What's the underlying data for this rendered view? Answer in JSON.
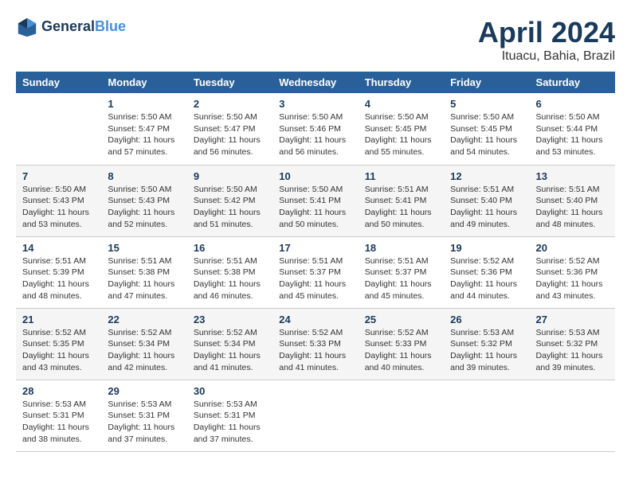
{
  "logo": {
    "line1": "General",
    "line2": "Blue"
  },
  "title": "April 2024",
  "subtitle": "Ituacu, Bahia, Brazil",
  "headers": [
    "Sunday",
    "Monday",
    "Tuesday",
    "Wednesday",
    "Thursday",
    "Friday",
    "Saturday"
  ],
  "weeks": [
    [
      {
        "day": "",
        "info": ""
      },
      {
        "day": "1",
        "info": "Sunrise: 5:50 AM\nSunset: 5:47 PM\nDaylight: 11 hours\nand 57 minutes."
      },
      {
        "day": "2",
        "info": "Sunrise: 5:50 AM\nSunset: 5:47 PM\nDaylight: 11 hours\nand 56 minutes."
      },
      {
        "day": "3",
        "info": "Sunrise: 5:50 AM\nSunset: 5:46 PM\nDaylight: 11 hours\nand 56 minutes."
      },
      {
        "day": "4",
        "info": "Sunrise: 5:50 AM\nSunset: 5:45 PM\nDaylight: 11 hours\nand 55 minutes."
      },
      {
        "day": "5",
        "info": "Sunrise: 5:50 AM\nSunset: 5:45 PM\nDaylight: 11 hours\nand 54 minutes."
      },
      {
        "day": "6",
        "info": "Sunrise: 5:50 AM\nSunset: 5:44 PM\nDaylight: 11 hours\nand 53 minutes."
      }
    ],
    [
      {
        "day": "7",
        "info": "Sunrise: 5:50 AM\nSunset: 5:43 PM\nDaylight: 11 hours\nand 53 minutes."
      },
      {
        "day": "8",
        "info": "Sunrise: 5:50 AM\nSunset: 5:43 PM\nDaylight: 11 hours\nand 52 minutes."
      },
      {
        "day": "9",
        "info": "Sunrise: 5:50 AM\nSunset: 5:42 PM\nDaylight: 11 hours\nand 51 minutes."
      },
      {
        "day": "10",
        "info": "Sunrise: 5:50 AM\nSunset: 5:41 PM\nDaylight: 11 hours\nand 50 minutes."
      },
      {
        "day": "11",
        "info": "Sunrise: 5:51 AM\nSunset: 5:41 PM\nDaylight: 11 hours\nand 50 minutes."
      },
      {
        "day": "12",
        "info": "Sunrise: 5:51 AM\nSunset: 5:40 PM\nDaylight: 11 hours\nand 49 minutes."
      },
      {
        "day": "13",
        "info": "Sunrise: 5:51 AM\nSunset: 5:40 PM\nDaylight: 11 hours\nand 48 minutes."
      }
    ],
    [
      {
        "day": "14",
        "info": "Sunrise: 5:51 AM\nSunset: 5:39 PM\nDaylight: 11 hours\nand 48 minutes."
      },
      {
        "day": "15",
        "info": "Sunrise: 5:51 AM\nSunset: 5:38 PM\nDaylight: 11 hours\nand 47 minutes."
      },
      {
        "day": "16",
        "info": "Sunrise: 5:51 AM\nSunset: 5:38 PM\nDaylight: 11 hours\nand 46 minutes."
      },
      {
        "day": "17",
        "info": "Sunrise: 5:51 AM\nSunset: 5:37 PM\nDaylight: 11 hours\nand 45 minutes."
      },
      {
        "day": "18",
        "info": "Sunrise: 5:51 AM\nSunset: 5:37 PM\nDaylight: 11 hours\nand 45 minutes."
      },
      {
        "day": "19",
        "info": "Sunrise: 5:52 AM\nSunset: 5:36 PM\nDaylight: 11 hours\nand 44 minutes."
      },
      {
        "day": "20",
        "info": "Sunrise: 5:52 AM\nSunset: 5:36 PM\nDaylight: 11 hours\nand 43 minutes."
      }
    ],
    [
      {
        "day": "21",
        "info": "Sunrise: 5:52 AM\nSunset: 5:35 PM\nDaylight: 11 hours\nand 43 minutes."
      },
      {
        "day": "22",
        "info": "Sunrise: 5:52 AM\nSunset: 5:34 PM\nDaylight: 11 hours\nand 42 minutes."
      },
      {
        "day": "23",
        "info": "Sunrise: 5:52 AM\nSunset: 5:34 PM\nDaylight: 11 hours\nand 41 minutes."
      },
      {
        "day": "24",
        "info": "Sunrise: 5:52 AM\nSunset: 5:33 PM\nDaylight: 11 hours\nand 41 minutes."
      },
      {
        "day": "25",
        "info": "Sunrise: 5:52 AM\nSunset: 5:33 PM\nDaylight: 11 hours\nand 40 minutes."
      },
      {
        "day": "26",
        "info": "Sunrise: 5:53 AM\nSunset: 5:32 PM\nDaylight: 11 hours\nand 39 minutes."
      },
      {
        "day": "27",
        "info": "Sunrise: 5:53 AM\nSunset: 5:32 PM\nDaylight: 11 hours\nand 39 minutes."
      }
    ],
    [
      {
        "day": "28",
        "info": "Sunrise: 5:53 AM\nSunset: 5:31 PM\nDaylight: 11 hours\nand 38 minutes."
      },
      {
        "day": "29",
        "info": "Sunrise: 5:53 AM\nSunset: 5:31 PM\nDaylight: 11 hours\nand 37 minutes."
      },
      {
        "day": "30",
        "info": "Sunrise: 5:53 AM\nSunset: 5:31 PM\nDaylight: 11 hours\nand 37 minutes."
      },
      {
        "day": "",
        "info": ""
      },
      {
        "day": "",
        "info": ""
      },
      {
        "day": "",
        "info": ""
      },
      {
        "day": "",
        "info": ""
      }
    ]
  ]
}
